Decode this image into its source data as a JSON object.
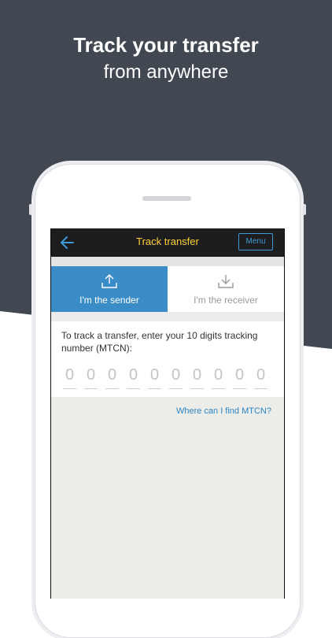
{
  "headline": {
    "title": "Track your transfer",
    "subtitle": "from anywhere"
  },
  "header": {
    "title": "Track transfer",
    "menu_label": "Menu",
    "back_icon": "back-arrow-icon"
  },
  "tabs": [
    {
      "label": "I'm the sender",
      "icon": "upload-icon",
      "active": true
    },
    {
      "label": "I'm the receiver",
      "icon": "download-icon",
      "active": false
    }
  ],
  "form": {
    "instruction": "To track a transfer, enter your 10 digits tracking number (MTCN):",
    "digit_placeholders": [
      "0",
      "0",
      "0",
      "0",
      "0",
      "0",
      "0",
      "0",
      "0",
      "0"
    ]
  },
  "help_link": "Where can I find MTCN?",
  "colors": {
    "background_dark": "#414851",
    "accent_blue": "#3a8cc6",
    "header_title_yellow": "#ffd133",
    "link_blue": "#2a85c6"
  }
}
